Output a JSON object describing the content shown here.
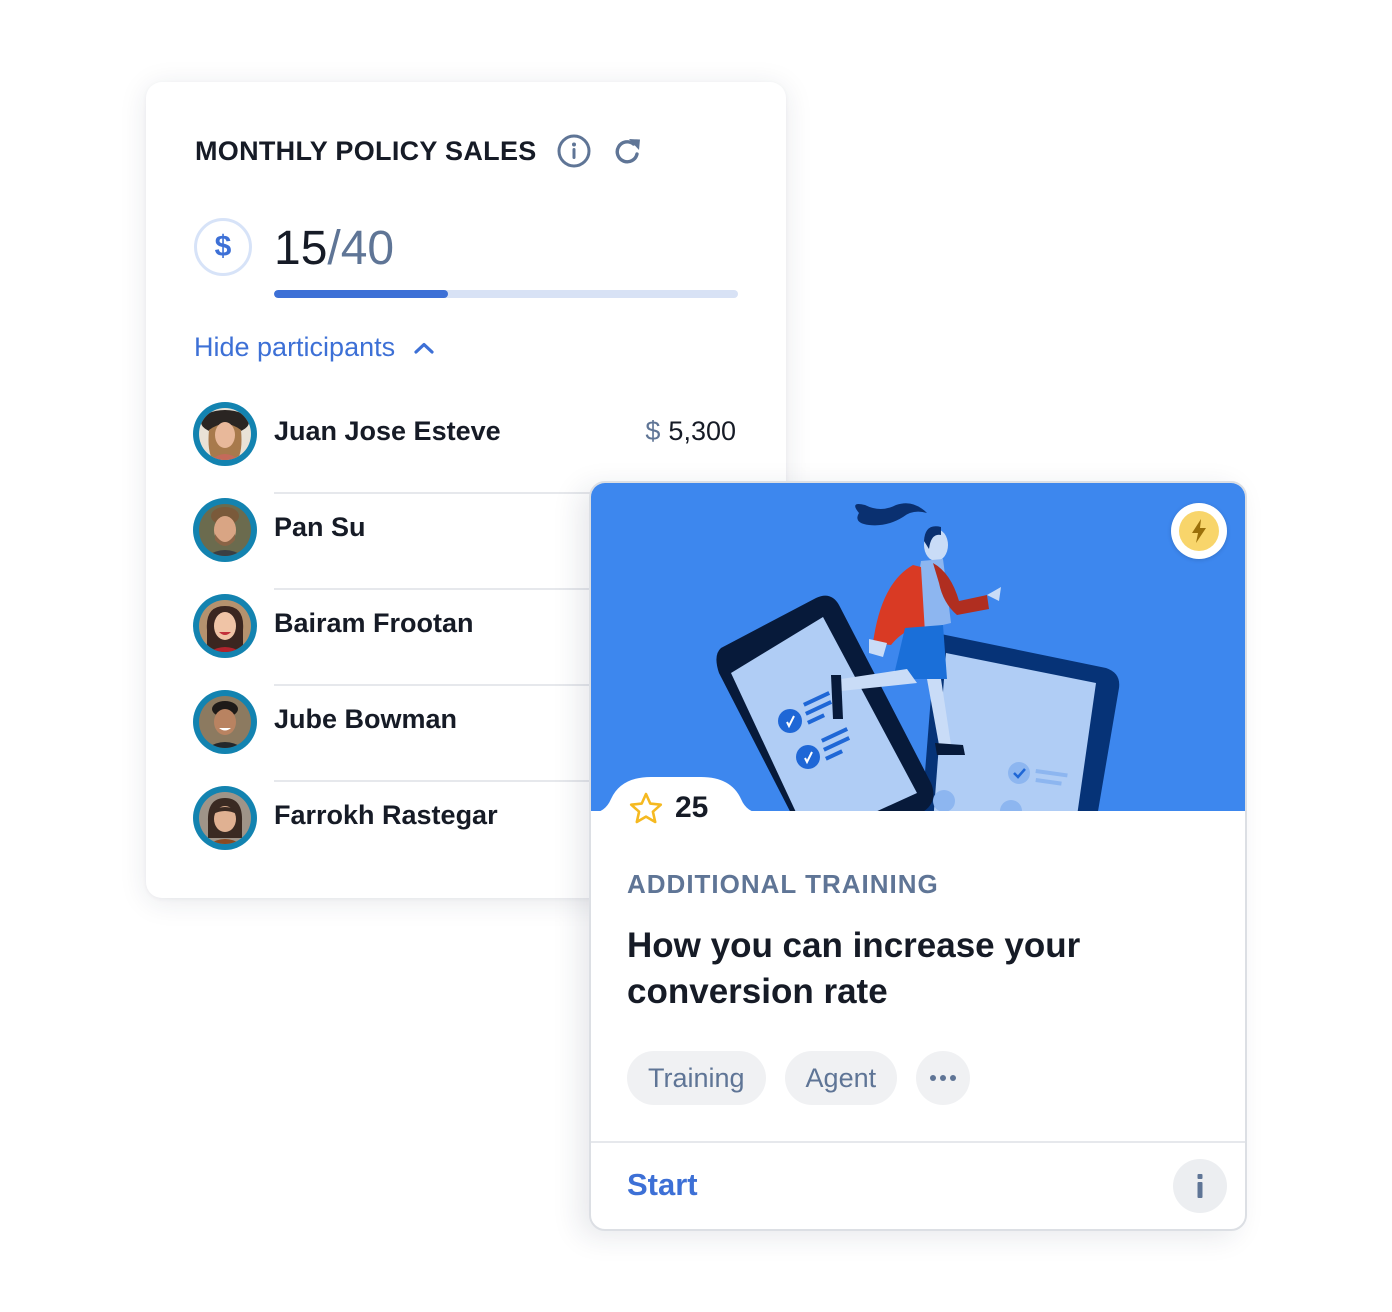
{
  "sales_card": {
    "title": "MONTHLY POLICY SALES",
    "info_icon": "info-circle-icon",
    "refresh_icon": "refresh-icon",
    "currency_icon": "dollar-icon",
    "currency_symbol": "$",
    "progress": {
      "current": "15",
      "separator": "/",
      "total": "40",
      "fraction": 0.375
    },
    "toggle_label": "Hide participants",
    "toggle_icon": "chevron-up-icon",
    "participants": [
      {
        "name": "Juan Jose Esteve",
        "amount_symbol": "$",
        "amount": "5,300"
      },
      {
        "name": "Pan Su",
        "amount_symbol": "",
        "amount": ""
      },
      {
        "name": "Bairam Frootan",
        "amount_symbol": "",
        "amount": ""
      },
      {
        "name": "Jube Bowman",
        "amount_symbol": "",
        "amount": ""
      },
      {
        "name": "Farrokh Rastegar",
        "amount_symbol": "",
        "amount": ""
      }
    ]
  },
  "training_card": {
    "badge_icon": "lightning-bolt-icon",
    "points_icon": "star-icon",
    "points": "25",
    "category": "ADDITIONAL TRAINING",
    "headline": "How you can increase your conversion rate",
    "tags": [
      "Training",
      "Agent"
    ],
    "more_icon": "more-horizontal-icon",
    "start_label": "Start",
    "info_icon": "info-icon"
  },
  "colors": {
    "accent_blue": "#3d70d6",
    "hero_blue": "#3d87ee",
    "muted_text": "#5f7596",
    "avatar_ring": "#1383b0",
    "badge_yellow": "#f8d56b",
    "star_yellow": "#f5b920"
  }
}
